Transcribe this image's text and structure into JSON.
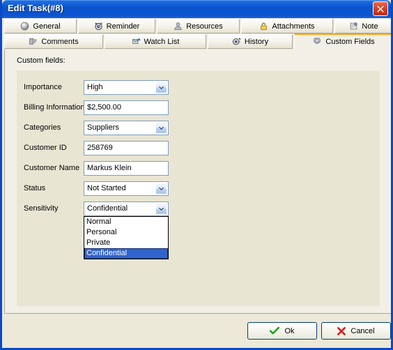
{
  "window": {
    "title": "Edit Task(#8)",
    "close_icon": "close-icon"
  },
  "tabs": {
    "row1": [
      {
        "label": "General",
        "icon": "sphere-icon"
      },
      {
        "label": "Reminder",
        "icon": "alarm-clock-icon"
      },
      {
        "label": "Resources",
        "icon": "person-icon"
      },
      {
        "label": "Attachments",
        "icon": "paperclip-lock-icon"
      },
      {
        "label": "Note",
        "icon": "note-pin-icon"
      }
    ],
    "row2": [
      {
        "label": "Comments",
        "icon": "comments-icon"
      },
      {
        "label": "Watch List",
        "icon": "watch-list-icon"
      },
      {
        "label": "History",
        "icon": "history-clock-icon"
      },
      {
        "label": "Custom Fields",
        "icon": "gear-icon",
        "selected": true
      }
    ]
  },
  "panel": {
    "heading": "Custom fields:",
    "fields": [
      {
        "label": "Importance",
        "value": "High",
        "type": "combo"
      },
      {
        "label": "Billing Information",
        "value": "$2,500.00",
        "type": "text"
      },
      {
        "label": "Categories",
        "value": "Suppliers",
        "type": "combo"
      },
      {
        "label": "Customer ID",
        "value": "258769",
        "type": "text"
      },
      {
        "label": "Customer Name",
        "value": "Markus Klein",
        "type": "text"
      },
      {
        "label": "Status",
        "value": "Not Started",
        "type": "combo"
      },
      {
        "label": "Sensitivity",
        "value": "Confidential",
        "type": "combo",
        "open": true
      }
    ],
    "dropdown": {
      "field": "Sensitivity",
      "options": [
        "Normal",
        "Personal",
        "Private",
        "Confidential"
      ],
      "selected": "Confidential"
    }
  },
  "buttons": {
    "ok": {
      "label": "Ok",
      "icon": "check-icon"
    },
    "cancel": {
      "label": "Cancel",
      "icon": "cross-icon"
    }
  },
  "colors": {
    "titlebar_blue": "#0b52cc",
    "window_border": "#0a49c8",
    "panel_beige": "#e9e5d3",
    "tab_selected_accent": "#f5a623",
    "selection_blue": "#3163ce",
    "ok_check_green": "#13a013",
    "cancel_x_red": "#d42020"
  }
}
